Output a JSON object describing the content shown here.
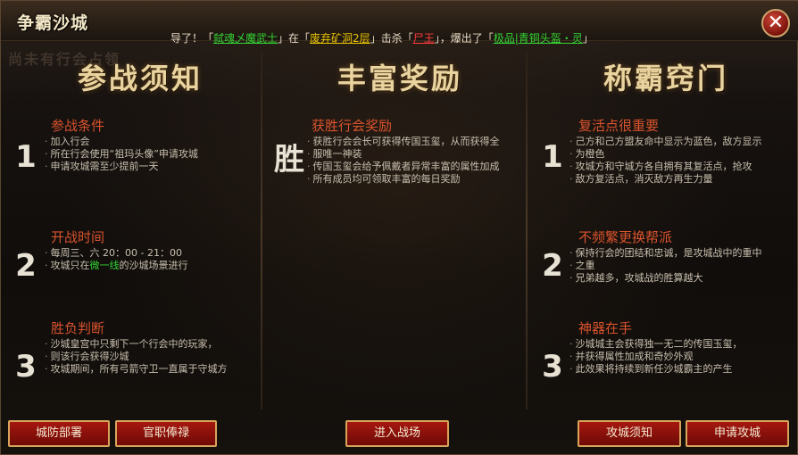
{
  "window": {
    "title": "争霸沙城",
    "close_glyph": "✕",
    "ghost_text": "尚未有行会占领"
  },
  "ticker": {
    "p1": "导了！「",
    "player": "弑魂乄魔武士",
    "p2": "」在「",
    "map": "废弃矿洞2层",
    "p3": "」击杀「",
    "monster": "尸王",
    "p4": "」，爆出了「",
    "item": "极品|青铜头盔・灵",
    "p5": "」"
  },
  "columns": [
    {
      "title": "参战须知",
      "sections": [
        {
          "number": "1",
          "heading": "参战条件",
          "lines": [
            "加入行会",
            "所在行会使用“祖玛头像”申请攻城",
            "申请攻城需至少提前一天"
          ]
        },
        {
          "number": "2",
          "heading": "开战时间",
          "lines": [
            "每周三、六 20：00 - 21：00"
          ],
          "line2_pre": "攻城只在",
          "line2_green": "微一线",
          "line2_post": "的沙城场景进行"
        },
        {
          "number": "3",
          "heading": "胜负判断",
          "lines": [
            "沙城皇宫中只剩下一个行会中的玩家，",
            "则该行会获得沙城",
            "攻城期间，所有弓箭守卫一直属于守城方"
          ]
        }
      ]
    },
    {
      "title": "丰富奖励",
      "sections": [
        {
          "number": "胜",
          "heading": "获胜行会奖励",
          "lines": [
            "获胜行会会长可获得传国玉玺，从而获得全",
            "服唯一神装",
            "传国玉玺会给予佩戴者异常丰富的属性加成",
            "所有成员均可领取丰富的每日奖励"
          ]
        }
      ]
    },
    {
      "title": "称霸窍门",
      "sections": [
        {
          "number": "1",
          "heading": "复活点很重要",
          "lines": [
            "己方和己方盟友命中显示为蓝色，敌方显示",
            "为橙色",
            "攻城方和守城方各自拥有其复活点，抢攻",
            "敌方复活点，消灭敌方再生力量"
          ]
        },
        {
          "number": "2",
          "heading": "不频繁更换帮派",
          "lines": [
            "保持行会的团结和忠诚，是攻城战中的重中",
            "之重",
            "兄弟越多，攻城战的胜算越大"
          ]
        },
        {
          "number": "3",
          "heading": "神器在手",
          "lines": [
            "沙城城主会获得独一无二的传国玉玺，",
            "并获得属性加成和奇妙外观",
            "此效果将持续到新任沙城霸主的产生"
          ]
        }
      ]
    }
  ],
  "buttons": {
    "defense": "城防部署",
    "officials": "官职俸禄",
    "enter": "进入战场",
    "siege_notice": "攻城须知",
    "apply": "申请攻城"
  }
}
